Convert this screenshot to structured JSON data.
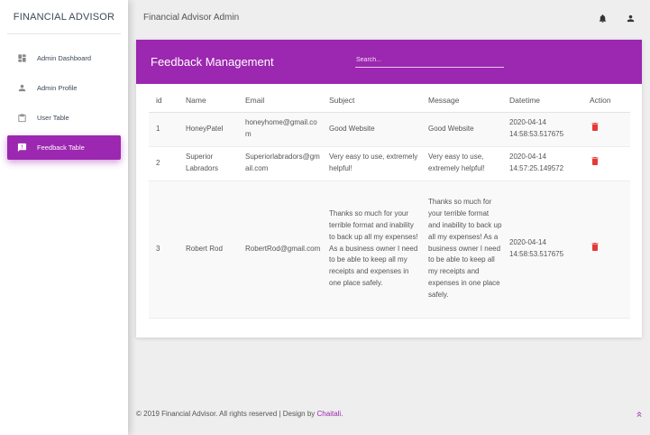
{
  "sidebar": {
    "brand": "FINANCIAL ADVISOR",
    "items": [
      {
        "label": "Admin Dashboard",
        "icon": "dashboard-icon"
      },
      {
        "label": "Admin Profile",
        "icon": "person-icon"
      },
      {
        "label": "User Table",
        "icon": "clipboard-icon"
      },
      {
        "label": "Feedback Table",
        "icon": "feedback-icon",
        "active": true
      }
    ]
  },
  "topbar": {
    "title": "Financial Advisor Admin",
    "icons": [
      "bell-icon",
      "user-icon"
    ]
  },
  "card": {
    "title_light": "Feedback ",
    "title_bold": "Management",
    "search_placeholder": "Search..."
  },
  "table": {
    "columns": [
      "id",
      "Name",
      "Email",
      "Subject",
      "Message",
      "Datetime",
      "Action"
    ],
    "rows": [
      {
        "id": "1",
        "name": "HoneyPatel",
        "email": "honeyhome@gmail.com",
        "subject": "Good Website",
        "message": "Good Website",
        "datetime": "2020-04-14 14:58:53.517675"
      },
      {
        "id": "2",
        "name": "Superior Labradors",
        "email": "Superiorlabradors@gmail.com",
        "subject": "Very easy to use, extremely helpful!",
        "message": "Very easy to use, extremely helpful!",
        "datetime": "2020-04-14 14:57:25.149572"
      },
      {
        "id": "3",
        "name": "Robert Rod",
        "email": "RobertRod@gmail.com",
        "subject": "Thanks so much for your terrible format and inability to back up all my expenses! As a business owner I need to be able to keep all my receipts and expenses in one place safely.",
        "message": "Thanks so much for your terrible format and inability to back up all my expenses! As a business owner I need to be able to keep all my receipts and expenses in one place safely.",
        "datetime": "2020-04-14 14:58:53.517675"
      }
    ]
  },
  "footer": {
    "text": "© 2019 Financial Advisor. All rights reserved | Design by ",
    "link": "Chaitali",
    "end": "."
  },
  "colors": {
    "accent": "#9c27b0",
    "delete": "#e53935"
  }
}
